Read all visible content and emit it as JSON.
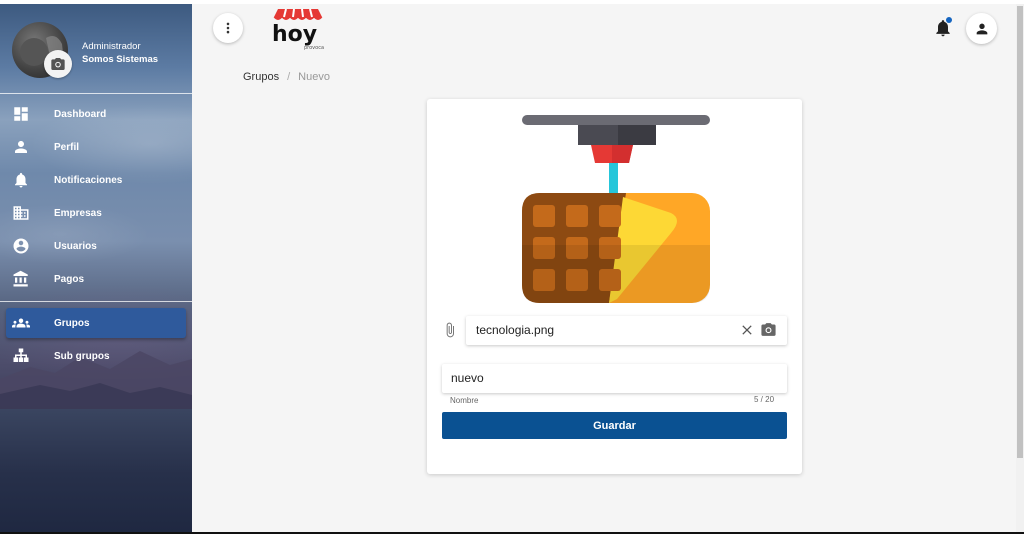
{
  "sidebar": {
    "profile": {
      "role": "Administrador",
      "name": "Somos Sistemas"
    },
    "items": [
      {
        "label": "Dashboard",
        "icon": "dashboard-icon"
      },
      {
        "label": "Perfil",
        "icon": "person-icon"
      },
      {
        "label": "Notificaciones",
        "icon": "bell-icon"
      },
      {
        "label": "Empresas",
        "icon": "business-icon"
      },
      {
        "label": "Usuarios",
        "icon": "account-circle-icon"
      },
      {
        "label": "Pagos",
        "icon": "bank-icon"
      },
      {
        "label": "Grupos",
        "icon": "groups-icon",
        "active": true
      },
      {
        "label": "Sub grupos",
        "icon": "sitemap-icon"
      }
    ]
  },
  "header": {
    "logo_text": "hoy",
    "logo_subtext": "provoca"
  },
  "breadcrumb": {
    "parent": "Grupos",
    "separator": "/",
    "current": "Nuevo"
  },
  "form": {
    "file_value": "tecnologia.png",
    "name_value": "nuevo",
    "name_label": "Nombre",
    "name_counter": "5 / 20",
    "save_label": "Guardar"
  },
  "colors": {
    "accent": "#0a5192",
    "active_nav": "#2f5a9c",
    "notification_dot": "#1565c0"
  }
}
